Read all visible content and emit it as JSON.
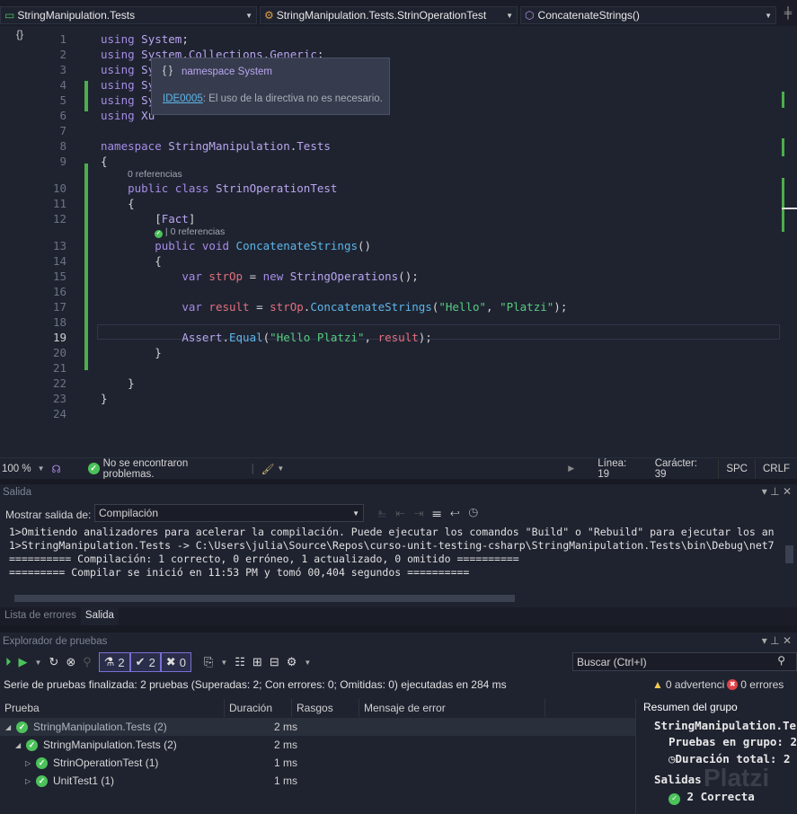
{
  "navbar": {
    "project": "StringManipulation.Tests",
    "class": "StringManipulation.Tests.StrinOperationTest",
    "member": "ConcatenateStrings()"
  },
  "tooltip": {
    "title": "namespace System",
    "code": "IDE0005",
    "message": ": El uso de la directiva no es necesario."
  },
  "code_lines": [
    {
      "n": "1",
      "t": [
        [
          "kw",
          "using"
        ],
        [
          "pu",
          " "
        ],
        [
          "ty",
          "System"
        ],
        [
          "pu",
          ";"
        ]
      ]
    },
    {
      "n": "2",
      "t": [
        [
          "kw",
          "using"
        ],
        [
          "pu",
          " "
        ],
        [
          "ty",
          "System"
        ],
        [
          "pu",
          "."
        ],
        [
          "ty",
          "Collections"
        ],
        [
          "pu",
          "."
        ],
        [
          "ty",
          "Generic"
        ],
        [
          "pu",
          ";"
        ]
      ]
    },
    {
      "n": "3",
      "t": [
        [
          "kw",
          "using"
        ],
        [
          "pu",
          " "
        ],
        [
          "ty",
          "Sy"
        ]
      ]
    },
    {
      "n": "4",
      "t": [
        [
          "kw",
          "using"
        ],
        [
          "pu",
          " "
        ],
        [
          "ty",
          "Sy"
        ]
      ]
    },
    {
      "n": "5",
      "t": [
        [
          "kw",
          "using"
        ],
        [
          "pu",
          " "
        ],
        [
          "ty",
          "Sy"
        ]
      ]
    },
    {
      "n": "6",
      "t": [
        [
          "kw",
          "using"
        ],
        [
          "pu",
          " "
        ],
        [
          "ty",
          "Xu"
        ]
      ]
    },
    {
      "n": "7",
      "t": []
    },
    {
      "n": "8",
      "t": [
        [
          "kw",
          "namespace"
        ],
        [
          "pu",
          " "
        ],
        [
          "ty",
          "StringManipulation"
        ],
        [
          "pu",
          "."
        ],
        [
          "ty",
          "Tests"
        ]
      ]
    },
    {
      "n": "9",
      "t": [
        [
          "pu",
          "{"
        ]
      ]
    },
    {
      "n": "10",
      "lens": "0 referencias",
      "t": [
        [
          "pu",
          "    "
        ],
        [
          "kw",
          "public"
        ],
        [
          "pu",
          " "
        ],
        [
          "kw",
          "class"
        ],
        [
          "pu",
          " "
        ],
        [
          "ty",
          "StrinOperationTest"
        ]
      ]
    },
    {
      "n": "11",
      "t": [
        [
          "pu",
          "    {"
        ]
      ]
    },
    {
      "n": "12",
      "t": [
        [
          "pu",
          "        ["
        ],
        [
          "ty",
          "Fact"
        ],
        [
          "pu",
          "]"
        ]
      ]
    },
    {
      "n": "13",
      "lens": "| 0 referencias",
      "lensok": true,
      "t": [
        [
          "pu",
          "        "
        ],
        [
          "kw",
          "public"
        ],
        [
          "pu",
          " "
        ],
        [
          "kw",
          "void"
        ],
        [
          "pu",
          " "
        ],
        [
          "fn",
          "ConcatenateStrings"
        ],
        [
          "pu",
          "()"
        ]
      ]
    },
    {
      "n": "14",
      "t": [
        [
          "pu",
          "        {"
        ]
      ]
    },
    {
      "n": "15",
      "t": [
        [
          "pu",
          "            "
        ],
        [
          "kw",
          "var"
        ],
        [
          "pu",
          " "
        ],
        [
          "lv",
          "strOp"
        ],
        [
          "pu",
          " = "
        ],
        [
          "kw",
          "new"
        ],
        [
          "pu",
          " "
        ],
        [
          "ty",
          "StringOperations"
        ],
        [
          "pu",
          "();"
        ]
      ]
    },
    {
      "n": "16",
      "t": []
    },
    {
      "n": "17",
      "t": [
        [
          "pu",
          "            "
        ],
        [
          "kw",
          "var"
        ],
        [
          "pu",
          " "
        ],
        [
          "lv",
          "result"
        ],
        [
          "pu",
          " = "
        ],
        [
          "lv",
          "strOp"
        ],
        [
          "pu",
          "."
        ],
        [
          "fn",
          "ConcatenateStrings"
        ],
        [
          "pu",
          "("
        ],
        [
          "st",
          "\"Hello\""
        ],
        [
          "pu",
          ", "
        ],
        [
          "st",
          "\"Platzi\""
        ],
        [
          "pu",
          ");"
        ]
      ]
    },
    {
      "n": "18",
      "t": []
    },
    {
      "n": "19",
      "t": [
        [
          "pu",
          "            "
        ],
        [
          "ty",
          "Assert"
        ],
        [
          "pu",
          "."
        ],
        [
          "fn",
          "Equal"
        ],
        [
          "pu",
          "("
        ],
        [
          "st",
          "\"Hello Platzi\""
        ],
        [
          "pu",
          ", "
        ],
        [
          "lv",
          "result"
        ],
        [
          "pu",
          ");"
        ]
      ]
    },
    {
      "n": "20",
      "t": [
        [
          "pu",
          "        }"
        ]
      ]
    },
    {
      "n": "21",
      "t": []
    },
    {
      "n": "22",
      "t": [
        [
          "pu",
          "    }"
        ]
      ]
    },
    {
      "n": "23",
      "t": [
        [
          "pu",
          "}"
        ]
      ]
    },
    {
      "n": "24",
      "t": []
    }
  ],
  "current_line": "19",
  "status": {
    "zoom": "100 %",
    "problems": "No se encontraron problemas.",
    "line": "Línea: 19",
    "char": "Carácter: 39",
    "spc": "SPC",
    "crlf": "CRLF"
  },
  "output": {
    "title": "Salida",
    "show_label": "Mostrar salida de:",
    "source": "Compilación",
    "lines": [
      "1>Omitiendo analizadores para acelerar la compilación. Puede ejecutar los comandos \"Build\" o \"Rebuild\" para ejecutar los an",
      "1>StringManipulation.Tests -> C:\\Users\\julia\\Source\\Repos\\curso-unit-testing-csharp\\StringManipulation.Tests\\bin\\Debug\\net7",
      "========== Compilación: 1 correcto, 0 erróneo, 1 actualizado, 0 omitido ==========",
      "========= Compilar se inició en 11:53 PM y tomó 00,404 segundos =========="
    ]
  },
  "bottom_tabs": [
    "Lista de errores",
    "Salida"
  ],
  "test_explorer": {
    "title": "Explorador de pruebas",
    "counts": {
      "total": "2",
      "passed": "2",
      "failed": "0"
    },
    "search_placeholder": "Buscar (Ctrl+I)",
    "summary": "Serie de pruebas finalizada: 2 pruebas (Superadas: 2; Con errores: 0; Omitidas: 0) ejecutadas en 284 ms",
    "warnings": "0 advertenci",
    "errors": "0 errores",
    "columns": [
      "Prueba",
      "Duración",
      "Rasgos",
      "Mensaje de error"
    ],
    "rows": [
      {
        "name": "StringManipulation.Tests (2)",
        "duration": "2 ms",
        "expanded": true,
        "level": 0
      },
      {
        "name": "StringManipulation.Tests (2)",
        "duration": "2 ms",
        "expanded": true,
        "level": 1
      },
      {
        "name": "StrinOperationTest (1)",
        "duration": "1 ms",
        "expanded": false,
        "level": 2
      },
      {
        "name": "UnitTest1 (1)",
        "duration": "1 ms",
        "expanded": false,
        "level": 2
      }
    ],
    "group_summary": {
      "title": "Resumen del grupo",
      "group": "StringManipulation.Te",
      "tests_in_group": "Pruebas en grupo: 2",
      "total_duration": "Duración total: 2",
      "outputs": "Salidas",
      "correct": "2 Correcta",
      "watermark": "Platzi"
    }
  },
  "colors": {
    "accent": "#7b6fd6",
    "success": "#4cc25a",
    "error": "#e0434b",
    "warning": "#f2c94c"
  }
}
